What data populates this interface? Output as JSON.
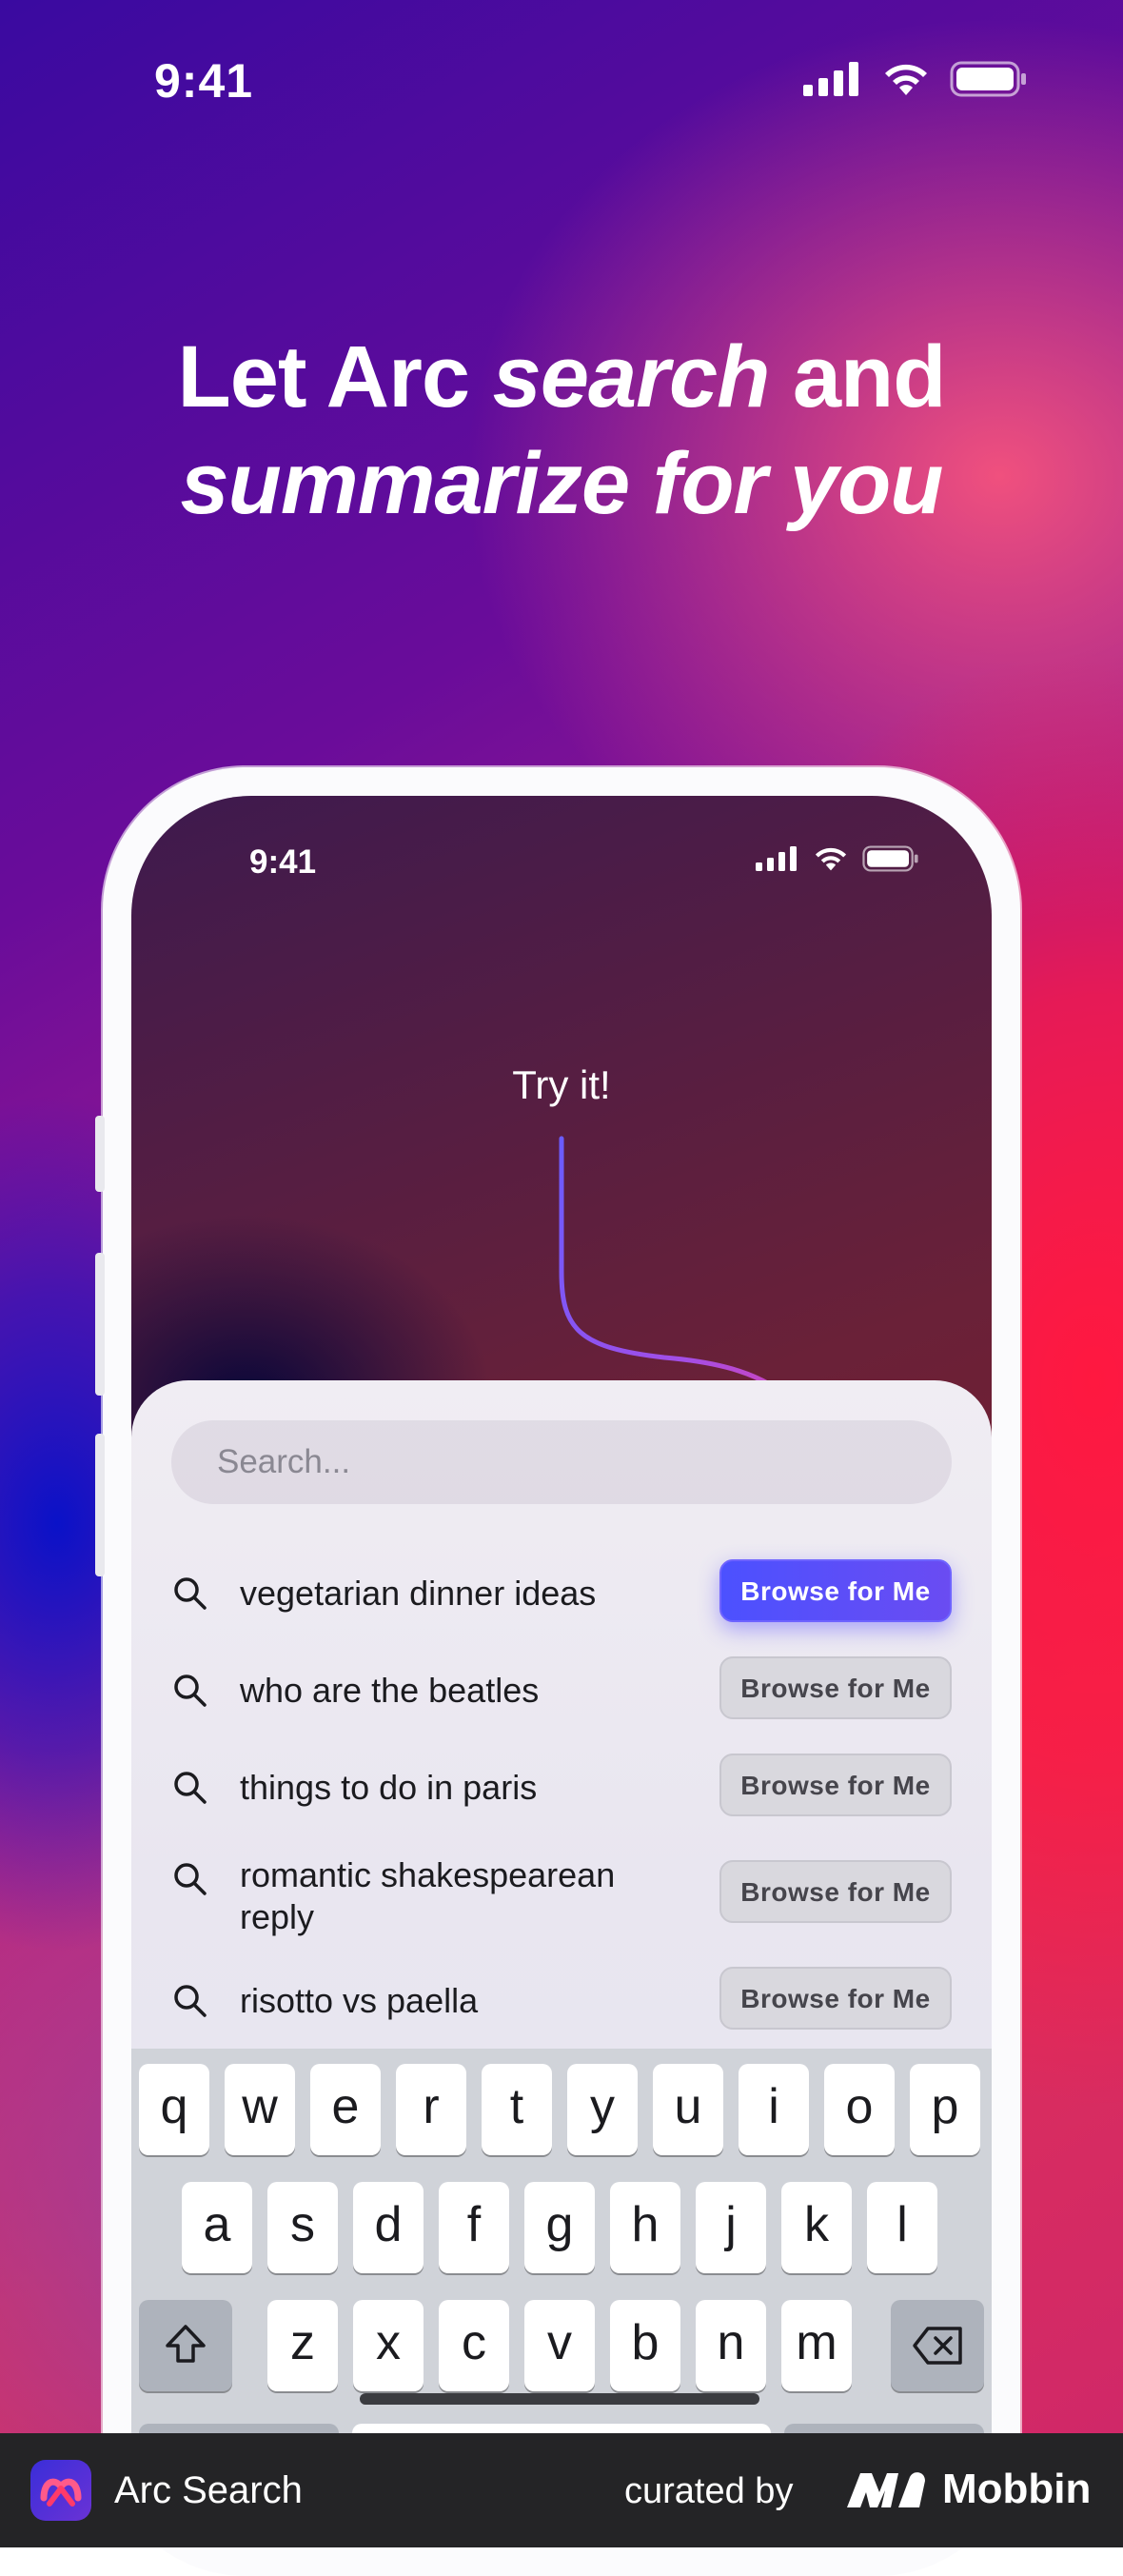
{
  "status_bar": {
    "time": "9:41"
  },
  "headline": {
    "line1_a": "Let Arc ",
    "line1_b": "search",
    "line1_c": " and",
    "line2": "summarize for you"
  },
  "phone": {
    "status_time": "9:41",
    "try_label": "Try it!",
    "search_placeholder": "Search...",
    "suggestions": [
      {
        "query": "vegetarian dinner ideas",
        "button": "Browse for Me",
        "highlighted": true
      },
      {
        "query": "who are the beatles",
        "button": "Browse for Me",
        "highlighted": false
      },
      {
        "query": "things to do in paris",
        "button": "Browse for Me",
        "highlighted": false
      },
      {
        "query": "romantic shakespearean reply",
        "button": "Browse for Me",
        "highlighted": false
      },
      {
        "query": "risotto vs paella",
        "button": "Browse for Me",
        "highlighted": false
      }
    ],
    "keyboard": {
      "row1": [
        "q",
        "w",
        "e",
        "r",
        "t",
        "y",
        "u",
        "i",
        "o",
        "p"
      ],
      "row2": [
        "a",
        "s",
        "d",
        "f",
        "g",
        "h",
        "j",
        "k",
        "l"
      ],
      "row3": [
        "z",
        "x",
        "c",
        "v",
        "b",
        "n",
        "m"
      ]
    }
  },
  "footer": {
    "app_name": "Arc Search",
    "curated_by": "curated by",
    "brand": "Mobbin"
  },
  "colors": {
    "accent": "#4c51ff",
    "arrow_end": "#ff3a8a"
  }
}
